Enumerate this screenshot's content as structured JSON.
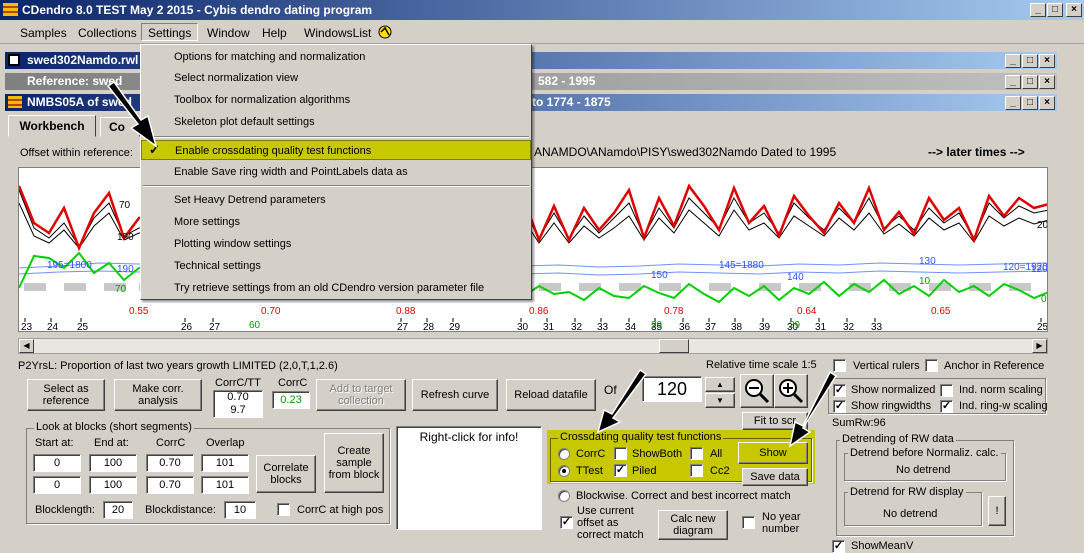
{
  "window": {
    "title": "CDendro 8.0  TEST May 2 2015 - Cybis dendro dating program",
    "buttons": [
      "_",
      "□",
      "×"
    ]
  },
  "menubar": {
    "items": [
      "Samples",
      "Collections",
      "Settings",
      "Window",
      "Help",
      "WindowsList"
    ]
  },
  "mdi": {
    "win1_title": "swed302Namdo.rwl (",
    "win2_title": "Reference: swed",
    "win2_suffix": "582 - 1995",
    "win3_title": "NMBS05A of swed",
    "win3_suffix": "to 1774 - 1875",
    "buttons": [
      "_",
      "□",
      "×"
    ]
  },
  "tabs": {
    "workbench": "Workbench",
    "second": "Co"
  },
  "offset_line": {
    "label": "Offset within reference:",
    "path": "ANAMDO\\ANamdo\\PISY\\swed302Namdo  Dated to 1995",
    "later": "--> later times -->"
  },
  "settings_menu": {
    "items": [
      "Options for matching and normalization",
      "Select normalization view",
      "Toolbox for normalization algorithms",
      "Skeleton plot default settings",
      "Enable crossdating quality test functions",
      "Enable Save ring width and PointLabels data as",
      "Set Heavy Detrend parameters",
      "More settings",
      "Plotting window settings",
      "Technical settings",
      "Try retrieve settings from an old CDendro version parameter file"
    ],
    "check_mark": "✓"
  },
  "chart_labels": {
    "red_values": [
      "0.55",
      "0.70",
      "0.88",
      "0.86",
      "0.78",
      "0.64",
      "0.65"
    ],
    "black_labels": [
      "70",
      "190",
      "20"
    ],
    "blue_labels": [
      "195=1800",
      "190",
      "150",
      "145=1880",
      "140",
      "130",
      "120=1920",
      "120"
    ],
    "green_labels": [
      "70",
      "10",
      "0"
    ],
    "ticks_black": [
      "23",
      "24",
      "25",
      "26",
      "27",
      "27",
      "28",
      "29",
      "30",
      "31",
      "32",
      "33",
      "34",
      "35",
      "36",
      "37",
      "38",
      "39",
      "30",
      "31",
      "32",
      "33",
      "25"
    ],
    "ticks_green": [
      "60",
      "29",
      "29"
    ],
    "sumrw": "SumRw:96"
  },
  "status": {
    "p2yrs": "P2YrsL: Proportion of last two years growth LIMITED (2,0,T,1,2.6)",
    "relative_scale": "Relative time scale 1:5"
  },
  "controls": {
    "select_ref": "Select as reference",
    "make_corr": "Make corr. analysis",
    "corrc_tt_label": "CorrC/TT",
    "corrc_tt_val1": "0.70",
    "corrc_tt_val2": "9.7",
    "corrc_label": "CorrC",
    "corrc_val": "0.23",
    "add_target": "Add to target collection",
    "refresh": "Refresh curve",
    "reload": "Reload datafile",
    "offset_label": "Of",
    "offset_value": "120",
    "fit_to": "Fit to scr",
    "vertical_rulers": "Vertical rulers",
    "anchor_ref": "Anchor in Reference",
    "show_normalized": "Show normalized",
    "ind_norm": "Ind. norm scaling",
    "show_ringwidths": "Show ringwidths",
    "ind_ringw": "Ind. ring-w scaling",
    "detrend_group": "Detrending of RW data",
    "detrend_before": "Detrend before Normaliz. calc.",
    "no_detrend1": "No detrend",
    "detrend_display": "Detrend for RW display",
    "no_detrend2": "No detrend",
    "excl": "!",
    "show_meanv": "ShowMeanV"
  },
  "blocks": {
    "group": "Look at blocks (short segments)",
    "start_label": "Start at:",
    "end_label": "End at:",
    "corrc_label": "CorrC",
    "overlap_label": "Overlap",
    "row1": [
      "0",
      "100",
      "0.70",
      "101"
    ],
    "row2": [
      "0",
      "100",
      "0.70",
      "101"
    ],
    "correlate": "Correlate blocks",
    "create_sample": "Create sample from block",
    "blocklength_label": "Blocklength:",
    "blocklength": "20",
    "blockdistance_label": "Blockdistance:",
    "blockdistance": "10",
    "corrc_high": "CorrC at high pos"
  },
  "info_box": {
    "text": "Right-click for info!"
  },
  "crossdating": {
    "group": "Crossdating quality test functions",
    "corrc": "CorrC",
    "showboth": "ShowBoth",
    "all": "All",
    "ttest": "TTest",
    "piled": "Piled",
    "cc2": "Cc2",
    "show": "Show",
    "save_data": "Save data",
    "blockwise": "Blockwise. Correct and best incorrect match",
    "use_current": "Use current offset as correct match",
    "calc_new": "Calc new diagram",
    "no_year": "No year number"
  },
  "colors": {
    "title_dark": "#0a246a",
    "title_light": "#a6caf0",
    "highlight": "#c8c800",
    "red": "#e00000",
    "green": "#00d000",
    "blue": "#3050ff"
  }
}
